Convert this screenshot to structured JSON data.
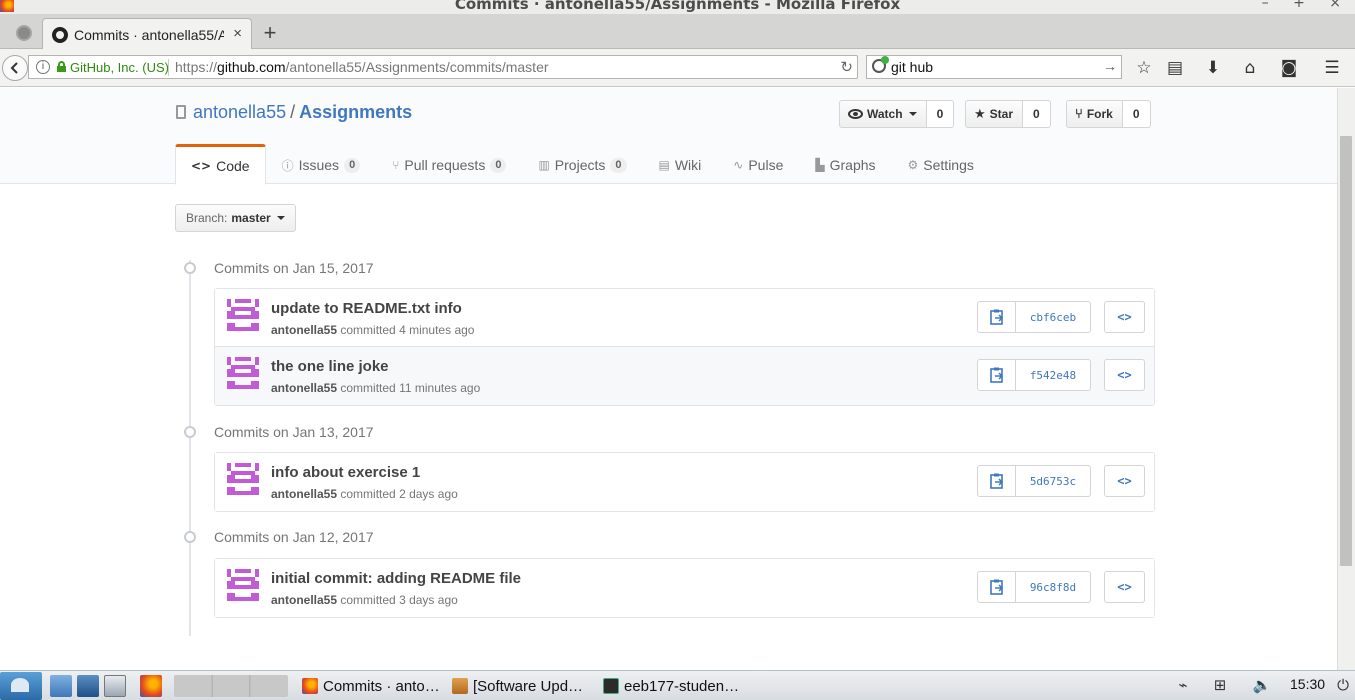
{
  "window": {
    "title": "Commits · antonella55/Assignments - Mozilla Firefox",
    "controls": "– + ×"
  },
  "tab": {
    "label": "Commits · antonella55/Assignments",
    "close": "×",
    "new_tab": "+"
  },
  "urlbar": {
    "identity": "GitHub, Inc. (US)",
    "url_prefix": "https://",
    "url_host": "github.com",
    "url_path": "/antonella55/Assignments/commits/master"
  },
  "searchbar": {
    "value": "git hub"
  },
  "repo": {
    "owner": "antonella55",
    "separator": "/",
    "name": "Assignments",
    "actions": [
      {
        "label": "Watch",
        "count": "0"
      },
      {
        "label": "Star",
        "count": "0"
      },
      {
        "label": "Fork",
        "count": "0"
      }
    ],
    "nav": [
      {
        "glyph": "<>",
        "label": "Code",
        "count": ""
      },
      {
        "glyph": "ⓘ",
        "label": "Issues",
        "count": "0"
      },
      {
        "glyph": "⑂",
        "label": "Pull requests",
        "count": "0"
      },
      {
        "glyph": "▥",
        "label": "Projects",
        "count": "0"
      },
      {
        "glyph": "▤",
        "label": "Wiki",
        "count": ""
      },
      {
        "glyph": "∿",
        "label": "Pulse",
        "count": ""
      },
      {
        "glyph": "▙",
        "label": "Graphs",
        "count": ""
      },
      {
        "glyph": "⚙",
        "label": "Settings",
        "count": ""
      }
    ]
  },
  "branch": {
    "prefix": "Branch:",
    "name": "master"
  },
  "commit_groups": [
    {
      "title": "Commits on Jan 15, 2017",
      "commits": [
        {
          "message": "update to README.txt info",
          "author": "antonella55",
          "verb": "committed",
          "time": "4 minutes ago",
          "sha": "cbf6ceb"
        },
        {
          "message": "the one line joke",
          "author": "antonella55",
          "verb": "committed",
          "time": "11 minutes ago",
          "sha": "f542e48"
        }
      ]
    },
    {
      "title": "Commits on Jan 13, 2017",
      "commits": [
        {
          "message": "info about exercise 1",
          "author": "antonella55",
          "verb": "committed",
          "time": "2 days ago",
          "sha": "5d6753c"
        }
      ]
    },
    {
      "title": "Commits on Jan 12, 2017",
      "commits": [
        {
          "message": "initial commit: adding README file",
          "author": "antonella55",
          "verb": "committed",
          "time": "3 days ago",
          "sha": "96c8f8d"
        }
      ]
    }
  ],
  "browse_glyph": "<>",
  "taskbar": {
    "tasks": [
      "Commits · anto…",
      "[Software Upd…",
      "eeb177-studen…"
    ],
    "clock": "15:30"
  },
  "colors": {
    "link": "#4078c0",
    "accent": "#e36209",
    "avatar": "#c25bd6"
  }
}
